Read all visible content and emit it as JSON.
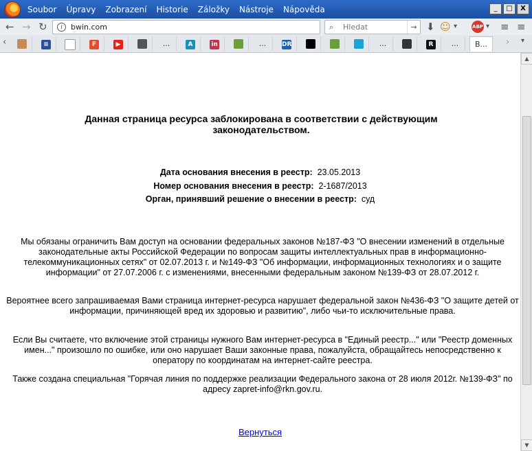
{
  "menu": [
    "Soubor",
    "Úpravy",
    "Zobrazení",
    "Historie",
    "Záložky",
    "Nástroje",
    "Nápověda"
  ],
  "window_buttons": {
    "minimize": "_",
    "maximize": "□",
    "close": "X"
  },
  "nav": {
    "url": "bwin.com",
    "search_placeholder": "Hledat",
    "abp_label": "ABP"
  },
  "tabs": {
    "favicons": [
      {
        "icon": "avatar-favicon",
        "text": "",
        "color": "#c98b55"
      },
      {
        "icon": "lines-favicon",
        "text": "≡",
        "color": "#2a4f9c"
      },
      {
        "icon": "bulb-favicon",
        "text": "",
        "color": "#ffffff"
      },
      {
        "icon": "f-favicon",
        "text": "F",
        "color": "#e44c2c"
      },
      {
        "icon": "youtube-favicon",
        "text": "▶",
        "color": "#e62117"
      },
      {
        "icon": "person-favicon",
        "text": "",
        "color": "#555555"
      },
      {
        "icon": "ellipsis",
        "text": "...",
        "color": ""
      },
      {
        "icon": "a-favicon",
        "text": "A",
        "color": "#1c8fb5"
      },
      {
        "icon": "in-favicon",
        "text": "in",
        "color": "#c4314b"
      },
      {
        "icon": "stack-favicon",
        "text": "",
        "color": "#6d9e3c"
      },
      {
        "icon": "ellipsis",
        "text": "...",
        "color": ""
      },
      {
        "icon": "dr-favicon",
        "text": "DR",
        "color": "#1a5fb4"
      },
      {
        "icon": "pirate-favicon",
        "text": "",
        "color": "#000000"
      },
      {
        "icon": "stack-favicon",
        "text": "",
        "color": "#6d9e3c"
      },
      {
        "icon": "swirl-favicon",
        "text": "",
        "color": "#1ba3d6"
      },
      {
        "icon": "ellipsis",
        "text": "...",
        "color": ""
      },
      {
        "icon": "arrows-favicon",
        "text": "",
        "color": "#333333"
      },
      {
        "icon": "r-favicon",
        "text": "R",
        "color": "#111111"
      },
      {
        "icon": "ellipsis",
        "text": "...",
        "color": ""
      }
    ],
    "active_label": "B..."
  },
  "page": {
    "heading": "Данная страница ресурса заблокирована в соответствии с действующим законодательством.",
    "info": [
      {
        "label": "Дата основания внесения в реестр:",
        "value": "23.05.2013"
      },
      {
        "label": "Номер основания внесения в реестр:",
        "value": "2-1687/2013"
      },
      {
        "label": "Орган, принявший решение о внесении в реестр:",
        "value": "суд"
      }
    ],
    "paragraphs": [
      "Мы обязаны ограничить Вам доступ на основании федеральных законов №187-ФЗ \"О внесении изменений в отдельные законодательные акты Российской Федерации по вопросам защиты интеллектуальных прав в информационно-телекоммуникационных сетях\" от 02.07.2013 г. и №149-ФЗ \"Об информации, информационных технологиях и о защите информации\" от 27.07.2006 г. с изменениями, внесенными федеральным законом №139-ФЗ от 28.07.2012 г.",
      "Вероятнее всего запрашиваемая Вами страница интернет-ресурса нарушает федеральной закон №436-ФЗ \"О защите детей от информации, причиняющей вред их здоровью и развитию\", либо чьи-то исключительные права.",
      "Если Вы считаете, что включение этой страницы нужного Вам интернет-ресурса в \"Единый реестр...\" или \"Реестр доменных имен...\" произошло по ошибке, или оно нарушает Ваши законные права, пожалуйста, обращайтесь непосредственно к оператору по координатам на интернет-сайте реестра.",
      "Также создана специальная \"Горячая линия по поддержке реализации Федерального закона от 28 июля 2012г. №139-ФЗ\" по адресу zapret-info@rkn.gov.ru."
    ],
    "back_link": "Вернуться"
  }
}
